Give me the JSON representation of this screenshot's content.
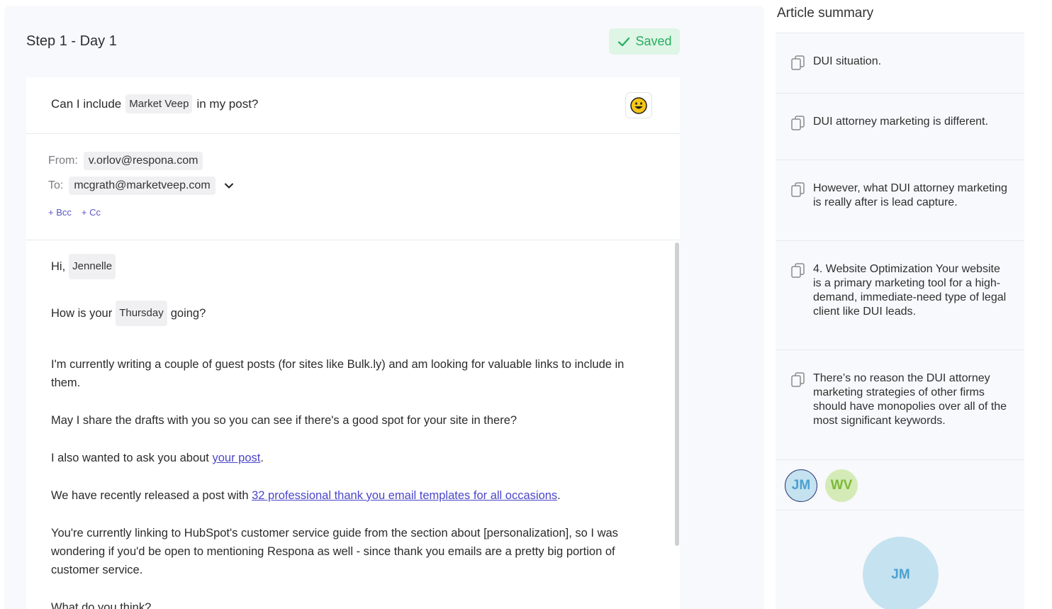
{
  "step": {
    "title": "Step 1 - Day 1",
    "saved_label": "Saved"
  },
  "subject": {
    "prefix": "Can I include",
    "variable": "Market Veep",
    "suffix": "in my post?"
  },
  "header": {
    "from_label": "From:",
    "from_value": "v.orlov@respona.com",
    "to_label": "To:",
    "to_value": "mcgrath@marketveep.com",
    "bcc_label": "+ Bcc",
    "cc_label": "+ Cc"
  },
  "body": {
    "greeting": "Hi,",
    "first_name": "Jennelle",
    "line2_prefix": "How is your",
    "weekday": "Thursday",
    "line2_suffix": "going?",
    "para1": "I'm currently writing a couple of guest posts (for sites like Bulk.ly) and am looking for valuable links to include in them.",
    "para2": "May I share the drafts with you so you can see if there's a good spot for your site in there?",
    "para3_prefix": "I also wanted to ask you about",
    "para3_link": "your post",
    "para3_suffix": ".",
    "para4_prefix": "We have recently released a post with",
    "para4_link": "32 professional thank you email templates for all occasions",
    "para4_suffix": ".",
    "para5": "You're currently linking to HubSpot's customer service guide from the section about [personalization], so I was wondering if you'd be open to mentioning Respona as well - since thank you emails are a pretty big portion of customer service.",
    "para6": "What do you think?"
  },
  "sidebar": {
    "title": "Article summary",
    "items": [
      "DUI situation.",
      "DUI attorney marketing is different.",
      "However, what DUI attorney marketing is really after is lead capture.",
      "4. Website Optimization Your website is a primary marketing tool for a high-demand, immediate-need type of legal client like DUI leads.",
      "There’s no reason the DUI attorney marketing strategies of other firms should have monopolies over all of the most significant keywords."
    ],
    "avatars": [
      "JM",
      "WV"
    ],
    "big_avatar": "JM"
  },
  "colors": {
    "accent_link": "#4b46c9",
    "saved_green": "#27ae60",
    "avatar_blue": "#4aa1cf",
    "avatar_green": "#7cb93a"
  },
  "icons": {
    "saved": "check-icon",
    "emoji": "smiley-emoji-icon",
    "to_dropdown": "chevron-down-icon",
    "summary": "copy-icon"
  }
}
